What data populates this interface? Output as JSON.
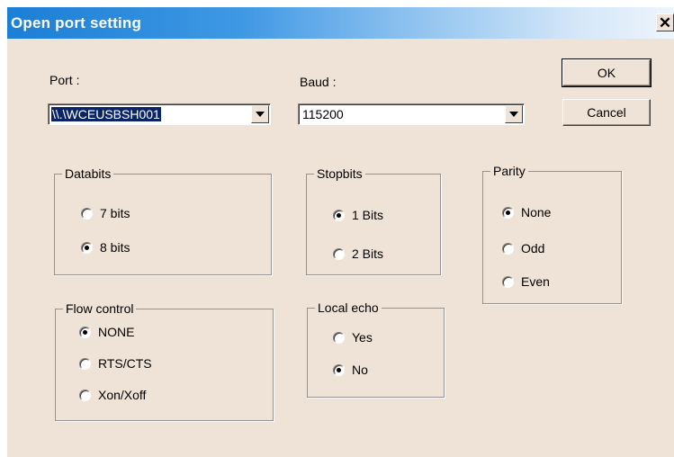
{
  "window": {
    "title": "Open port setting",
    "close_glyph": "✕"
  },
  "port": {
    "label": "Port :",
    "value": "\\\\.\\WCEUSBSH001"
  },
  "baud": {
    "label": "Baud :",
    "value": "115200"
  },
  "buttons": {
    "ok": "OK",
    "cancel": "Cancel"
  },
  "databits": {
    "title": "Databits",
    "options": [
      "7 bits",
      "8 bits"
    ],
    "selected": "8 bits"
  },
  "stopbits": {
    "title": "Stopbits",
    "options": [
      "1 Bits",
      "2 Bits"
    ],
    "selected": "1 Bits"
  },
  "parity": {
    "title": "Parity",
    "options": [
      "None",
      "Odd",
      "Even"
    ],
    "selected": "None"
  },
  "flow": {
    "title": "Flow control",
    "options": [
      "NONE",
      "RTS/CTS",
      "Xon/Xoff"
    ],
    "selected": "NONE"
  },
  "echo": {
    "title": "Local echo",
    "options": [
      "Yes",
      "No"
    ],
    "selected": "No"
  },
  "icons": {
    "close": "close-icon",
    "dropdown": "chevron-down-icon",
    "radio": "radio-icon"
  }
}
